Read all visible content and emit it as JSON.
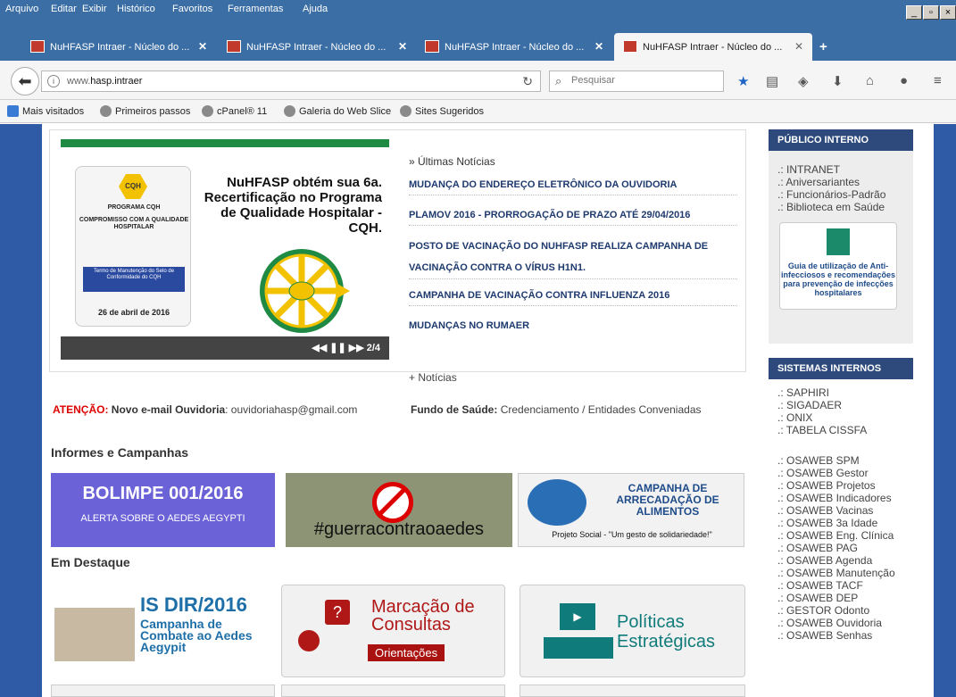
{
  "menu": [
    "Arquivo",
    "Editar",
    "Exibir",
    "Histórico",
    "Favoritos",
    "Ferramentas",
    "Ajuda"
  ],
  "tabs": [
    {
      "label": "NuHFASP Intraer - Núcleo do ...",
      "active": false
    },
    {
      "label": "NuHFASP Intraer - Núcleo do ...",
      "active": false
    },
    {
      "label": "NuHFASP Intraer - Núcleo do ...",
      "active": false
    },
    {
      "label": "NuHFASP Intraer - Núcleo do ...",
      "active": true
    }
  ],
  "newtab_symbol": "+",
  "address": {
    "prefix": "www.",
    "host": "hasp.intraer"
  },
  "search": {
    "placeholder": "Pesquisar"
  },
  "bookmarks": [
    "Mais visitados",
    "Primeiros passos",
    "cPanel® 11",
    "Galeria do Web Slice",
    "Sites Sugeridos"
  ],
  "slide": {
    "seal": "CQH",
    "cert_title": "PROGRAMA CQH",
    "cert_sub": "COMPROMISSO COM A QUALIDADE HOSPITALAR",
    "cert_box": "Termo de Manutenção do Selo de Conformidade do CQH",
    "cert_date": "26 de abril de 2016",
    "headline": "NuHFASP obtém sua 6a. Recertificação no Programa de Qualidade Hospitalar - CQH.",
    "controls": "◀◀  ❚❚  ▶▶   2/4"
  },
  "news": {
    "label": "» Últimas Notícias",
    "items": [
      "MUDANÇA DO ENDEREÇO ELETRÔNICO DA OUVIDORIA",
      "PLAMOV 2016 - PRORROGAÇÃO DE PRAZO ATÉ 29/04/2016",
      "POSTO DE VACINAÇÃO DO NUHFASP REALIZA CAMPANHA DE VACINAÇÃO CONTRA O VÍRUS H1N1.",
      "CAMPANHA DE VACINAÇÃO CONTRA INFLUENZA 2016",
      "MUDANÇAS NO RUMAER"
    ],
    "more": "+ Notícias"
  },
  "alert": {
    "label": "ATENÇÃO:",
    "bold": "Novo e-mail Ouvidoria",
    "text": ": ouvidoriahasp@gmail.com",
    "fundo_label": "Fundo de Saúde:",
    "fundo_text": "Credenciamento / Entidades Conveniadas"
  },
  "informes": {
    "title": "Informes e Campanhas",
    "bolimpe_title": "BOLIMPE 001/2016",
    "bolimpe_sub": "ALERTA SOBRE O AEDES AEGYPTI",
    "guerra": "#guerracontraoaedes",
    "camp_title": "CAMPANHA DE ARRECADAÇÃO DE ALIMENTOS",
    "camp_sub": "Projeto Social - \"Um gesto de solidariedade!\""
  },
  "destaque": {
    "title": "Em Destaque",
    "isdir_title": "IS DIR/2016",
    "isdir_sub": "Campanha de Combate ao Aedes Aegypit",
    "marc_title": "Marcação de Consultas",
    "marc_sub": "Orientações",
    "pol_title": "Políticas Estratégicas"
  },
  "publico": {
    "header": "PÚBLICO INTERNO",
    "links": [
      ".: INTRANET",
      ".: Aniversariantes",
      ".: Funcionários-Padrão",
      ".: Biblioteca em Saúde"
    ],
    "guide": "Guia de utilização de Anti-infecciosos e recomendações para prevenção de infecções hospitalares"
  },
  "sistemas": {
    "header": "SISTEMAS INTERNOS",
    "group1": [
      ".: SAPHIRI",
      ".: SIGADAER",
      ".: ONIX",
      ".: TABELA CISSFA"
    ],
    "group2": [
      ".: OSAWEB SPM",
      ".: OSAWEB Gestor",
      ".: OSAWEB Projetos",
      ".: OSAWEB Indicadores",
      ".: OSAWEB Vacinas",
      ".: OSAWEB 3a Idade",
      ".: OSAWEB Eng. Clínica",
      ".: OSAWEB PAG",
      ".: OSAWEB Agenda",
      ".: OSAWEB Manutenção",
      ".: OSAWEB TACF",
      ".: OSAWEB DEP",
      ".: GESTOR Odonto",
      ".: OSAWEB Ouvidoria",
      ".: OSAWEB Senhas"
    ]
  }
}
